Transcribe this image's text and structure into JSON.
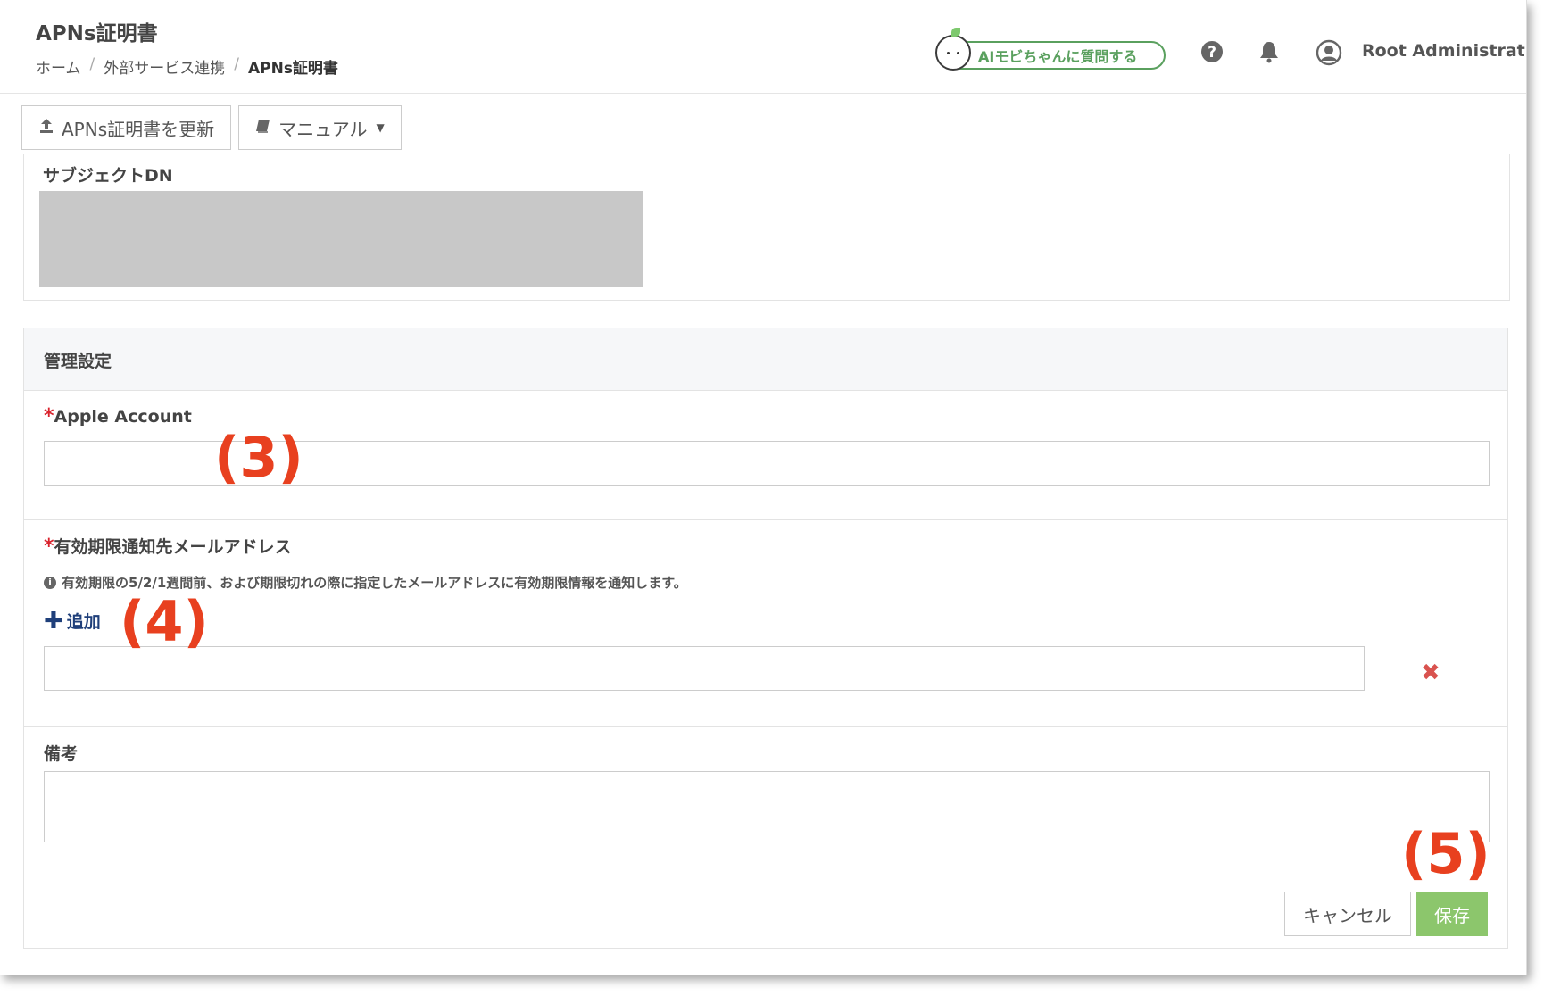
{
  "header": {
    "title": "APNs証明書",
    "breadcrumb": {
      "home": "ホーム",
      "section": "外部サービス連携",
      "current": "APNs証明書",
      "separator": "/"
    },
    "ai_button_label": "AIモビちゃんに質問する",
    "username": "Root Administrat..."
  },
  "toolbar": {
    "update_label": "APNs証明書を更新",
    "manual_label": "マニュアル"
  },
  "subject": {
    "label": "サブジェクトDN"
  },
  "settings": {
    "title": "管理設定",
    "required_mark": "*",
    "apple_account": {
      "label": "Apple Account",
      "value": ""
    },
    "notify_email": {
      "label": "有効期限通知先メールアドレス",
      "help": "有効期限の5/2/1週間前、および期限切れの際に指定したメールアドレスに有効期限情報を通知します。",
      "add_label": "追加",
      "value": ""
    },
    "remarks": {
      "label": "備考",
      "value": ""
    }
  },
  "actions": {
    "cancel_label": "キャンセル",
    "save_label": "保存"
  },
  "annotations": {
    "a3": "(3)",
    "a4": "(4)",
    "a5": "(5)"
  },
  "colors": {
    "required": "#d9232d",
    "save_button": "#8cc66c",
    "annotation": "#e8401f",
    "ai_button": "#5aa05e",
    "add_link": "#1f3f7a"
  }
}
